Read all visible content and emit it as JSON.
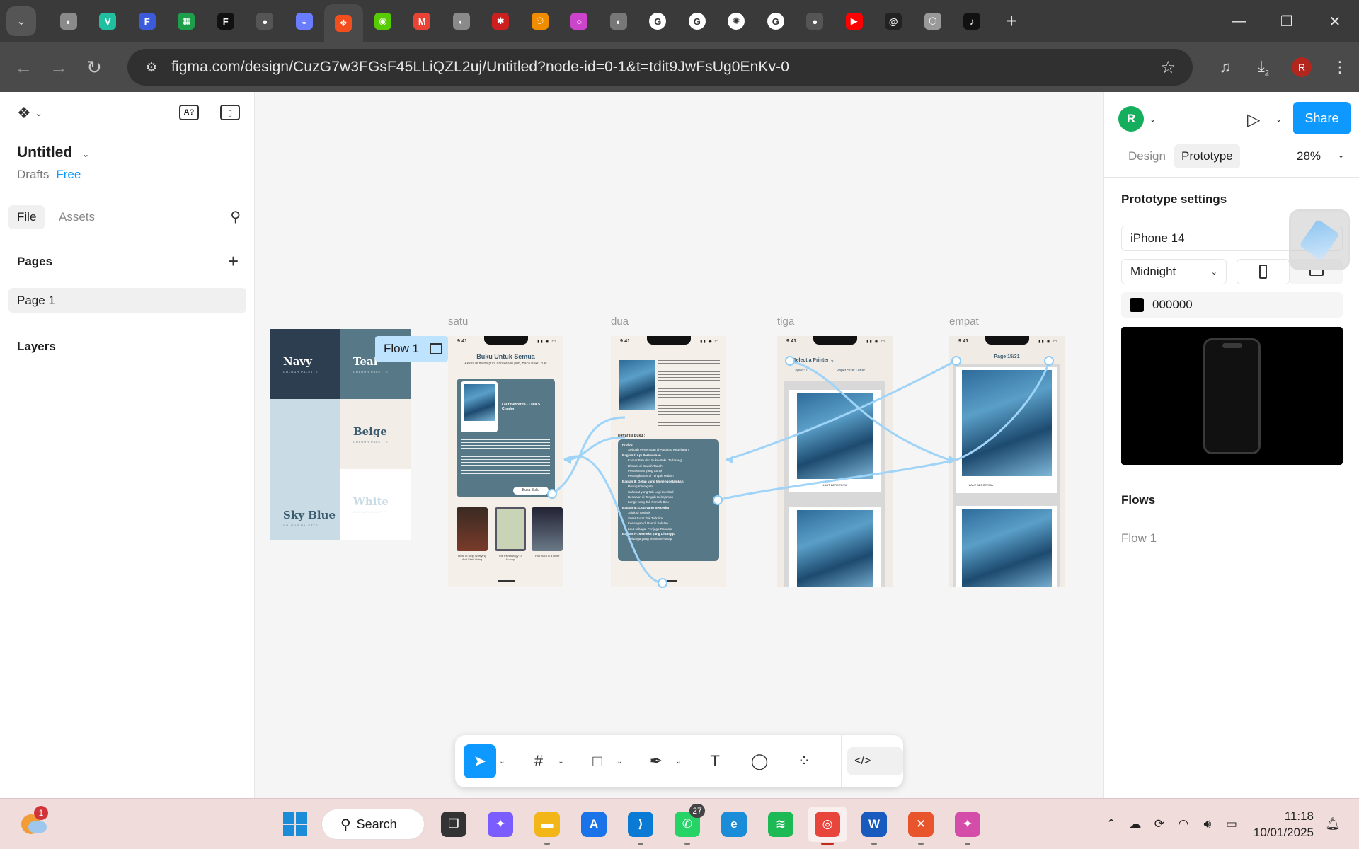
{
  "browser": {
    "tab_favicons": [
      {
        "name": "generic-globe-icon",
        "color": "#8a8a8a",
        "glyph": "◐"
      },
      {
        "name": "vercel-app-icon",
        "color": "#1fbf9f",
        "glyph": "V"
      },
      {
        "name": "forms-icon",
        "color": "#3b5bdb",
        "glyph": "F"
      },
      {
        "name": "sheets-icon",
        "color": "#1e9e4a",
        "glyph": "▦"
      },
      {
        "name": "f-letter-icon",
        "color": "#111111",
        "glyph": "F"
      },
      {
        "name": "github-icon",
        "color": "#555555",
        "glyph": "●"
      },
      {
        "name": "ufo-icon",
        "color": "#6a7cff",
        "glyph": "◒"
      },
      {
        "name": "figma-icon",
        "color": "#f24e1e",
        "glyph": "❖"
      },
      {
        "name": "duolingo-icon",
        "color": "#58cc02",
        "glyph": "◉"
      },
      {
        "name": "gmail-icon",
        "color": "#ea4335",
        "glyph": "M"
      },
      {
        "name": "generic-globe-icon",
        "color": "#8a8a8a",
        "glyph": "◐"
      },
      {
        "name": "spider-app-icon",
        "color": "#cc2020",
        "glyph": "✱"
      },
      {
        "name": "orange-app-icon",
        "color": "#f08c00",
        "glyph": "⚇"
      },
      {
        "name": "ring-icon",
        "color": "#cc44cc",
        "glyph": "○"
      },
      {
        "name": "generic-globe-icon",
        "color": "#777777",
        "glyph": "◐"
      },
      {
        "name": "google-icon",
        "color": "#ffffff",
        "glyph": "G"
      },
      {
        "name": "google-icon",
        "color": "#ffffff",
        "glyph": "G"
      },
      {
        "name": "chatgpt-icon",
        "color": "#ffffff",
        "glyph": "✺"
      },
      {
        "name": "google-icon",
        "color": "#ffffff",
        "glyph": "G"
      },
      {
        "name": "github-icon",
        "color": "#555555",
        "glyph": "●"
      },
      {
        "name": "youtube-icon",
        "color": "#ff0000",
        "glyph": "▶"
      },
      {
        "name": "threads-icon",
        "color": "#222222",
        "glyph": "@"
      },
      {
        "name": "cube-icon",
        "color": "#999999",
        "glyph": "⬡"
      },
      {
        "name": "tiktok-icon",
        "color": "#111111",
        "glyph": "♪"
      }
    ],
    "active_tab_index": 7,
    "url": "figma.com/design/CuzG7w3FGsF45LLiQZL2uj/Untitled?node-id=0-1&t=tdit9JwFsUg0EnKv-0",
    "download_count": "2",
    "profile_initial": "R"
  },
  "figma": {
    "file_title": "Untitled",
    "drafts_label": "Drafts",
    "plan_label": "Free",
    "left_tabs": [
      "File",
      "Assets"
    ],
    "pages_heading": "Pages",
    "pages": [
      "Page 1"
    ],
    "layers_heading": "Layers",
    "canvas": {
      "flow_badge": "Flow 1",
      "palette": [
        {
          "name": "Navy",
          "sub": "COLOUR PALETTE",
          "bg": "#2c3e50",
          "fg": "#ffffff"
        },
        {
          "name": "Teal",
          "sub": "COLOUR PALETTE",
          "bg": "#577887",
          "fg": "#ffffff"
        },
        {
          "name": "Sky Blue",
          "sub": "COLOUR PALETTE",
          "bg": "#c9dce6",
          "fg": "#3a5a6e"
        },
        {
          "name": "Beige",
          "sub": "COLOUR PALETTE",
          "bg": "#f3ede8",
          "fg": "#3a5a6e"
        },
        {
          "name": "White",
          "sub": "COLOUR PALETTE",
          "bg": "#ffffff",
          "fg": "#c9dce6"
        }
      ],
      "frames": [
        {
          "label": "satu",
          "time": "9:41",
          "title": "Buku Untuk Semua",
          "subtitle": "Akses di mana pun, dan kapan pun, Baca Buku Yuk!",
          "card_title": "Laut Bercerita - Leila S Chudori",
          "button": "Buka Buku",
          "books": [
            "How To Stop Worrying And Start Living",
            "The Psychology Of Money",
            "Your Soul Is a River"
          ]
        },
        {
          "label": "dua",
          "time": "9:41",
          "toc_heading": "Daftar Isi Buku :",
          "toc": [
            "Prolog",
            "Sebuah Pertemuan di Ambang Kegelapan",
            "Bagian I: Api Perlawanan",
            "Kamar Biru dan Buku-Buku Terlarang",
            "Diskusi di Bawah Tanah",
            "Perlawanan yang Sunyi",
            "Penangkapan di Tengah Malam",
            "Bagian II: Gelap yang Menenggelamkan",
            "Ruang Interogasi",
            "Sahabat yang Tak Lagi Kembali",
            "Bertahan di Tengah Kekejaman",
            "Langit yang Tak Pernah Biru",
            "Bagian III: Laut yang Bercerita",
            "Jejak di Ombak",
            "Surat-Surat Tak Terkirim",
            "Kenangan di Pantai Selatan",
            "Laut sebagai Penjaga Rahasia",
            "Bagian IV: Memeka yang Ditunggu",
            "Keluarga yang Terus Berharap"
          ]
        },
        {
          "label": "tiga",
          "time": "9:41",
          "header": "Select a Printer",
          "opt1": "Copies: 1",
          "opt2": "Paper Size: Letter",
          "caption": "LAUT BERCERITA"
        },
        {
          "label": "empat",
          "time": "9:41",
          "header": "Page 15/31",
          "caption": "LAUT BERCERITA"
        }
      ]
    },
    "toolbar": {
      "tools": [
        {
          "name": "move-tool-icon",
          "glyph": "➤",
          "active": true,
          "caret": true
        },
        {
          "name": "frame-tool-icon",
          "glyph": "#",
          "active": false,
          "caret": true
        },
        {
          "name": "rectangle-tool-icon",
          "glyph": "□",
          "active": false,
          "caret": true
        },
        {
          "name": "pen-tool-icon",
          "glyph": "✒",
          "active": false,
          "caret": true
        },
        {
          "name": "text-tool-icon",
          "glyph": "T",
          "active": false,
          "caret": false
        },
        {
          "name": "comment-tool-icon",
          "glyph": "◯",
          "active": false,
          "caret": false
        },
        {
          "name": "actions-tool-icon",
          "glyph": "⁘",
          "active": false,
          "caret": false
        }
      ],
      "dev_mode_glyph": "</>"
    },
    "right_panel": {
      "avatar_initial": "R",
      "share_label": "Share",
      "tabs": [
        "Design",
        "Prototype"
      ],
      "active_tab": "Prototype",
      "zoom": "28%",
      "prototype_settings_heading": "Prototype settings",
      "device": "iPhone 14",
      "device_color": "Midnight",
      "background_hex": "000000",
      "flows_heading": "Flows",
      "flows": [
        "Flow 1"
      ]
    }
  },
  "taskbar": {
    "weather_badge": "1",
    "search_label": "Search",
    "apps": [
      {
        "name": "task-view-icon",
        "color": "#333333",
        "glyph": "❐",
        "running": false
      },
      {
        "name": "copilot-icon",
        "color": "#7a5cff",
        "glyph": "✦",
        "running": false
      },
      {
        "name": "file-explorer-icon",
        "color": "#f2b619",
        "glyph": "▬",
        "running": true
      },
      {
        "name": "app-store-icon",
        "color": "#1a73e8",
        "glyph": "A",
        "running": false
      },
      {
        "name": "vscode-icon",
        "color": "#0a7ad4",
        "glyph": "⟩",
        "running": true
      },
      {
        "name": "whatsapp-icon",
        "color": "#25d366",
        "glyph": "✆",
        "running": true,
        "count": "27"
      },
      {
        "name": "edge-icon",
        "color": "#1a8cd8",
        "glyph": "e",
        "running": false
      },
      {
        "name": "spotify-icon",
        "color": "#1db954",
        "glyph": "≋",
        "running": false
      },
      {
        "name": "chrome-icon",
        "color": "#e8453c",
        "glyph": "◎",
        "running": true,
        "active": true
      },
      {
        "name": "word-icon",
        "color": "#185abd",
        "glyph": "W",
        "running": true
      },
      {
        "name": "xampp-icon",
        "color": "#e8542c",
        "glyph": "✕",
        "running": true
      },
      {
        "name": "colorful-app-icon",
        "color": "#d44da8",
        "glyph": "✦",
        "running": true
      }
    ],
    "time": "11:18",
    "date": "10/01/2025"
  }
}
